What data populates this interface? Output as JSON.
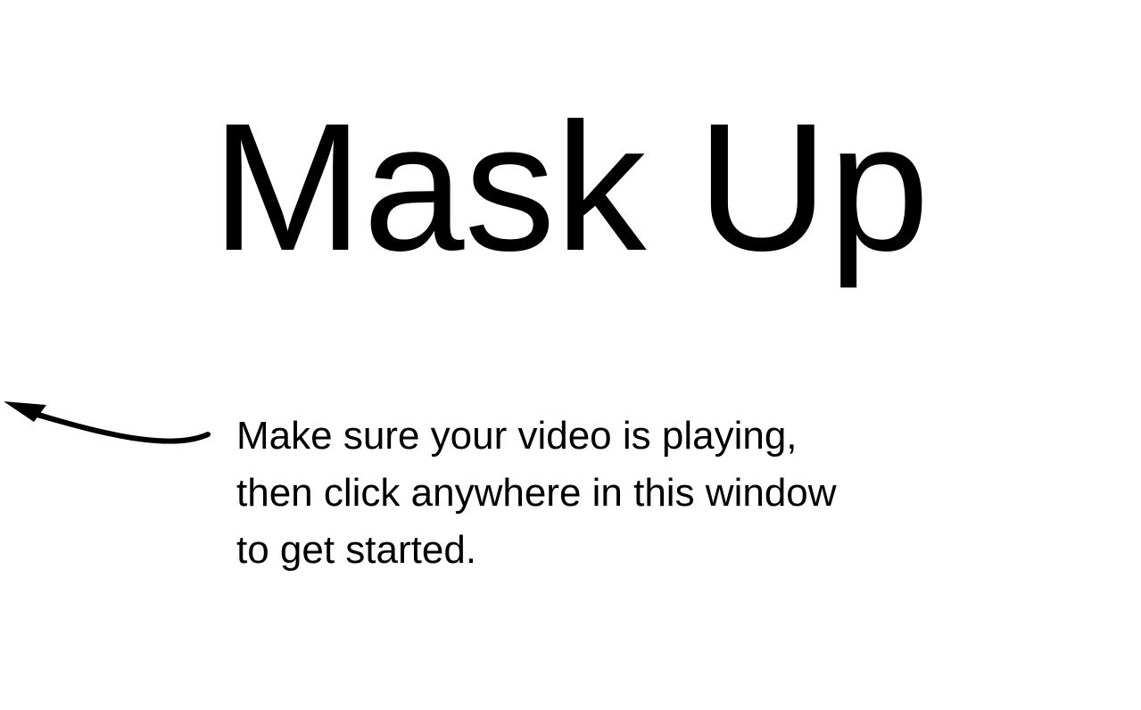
{
  "title": "Mask Up",
  "instructions": {
    "lines": [
      "Make sure your video is playing,",
      "then click anywhere in this window",
      "to get started."
    ]
  },
  "arrow": {
    "icon": "curved-arrow-left-icon",
    "color": "#000000"
  },
  "colors": {
    "background": "#ffffff",
    "text": "#000000"
  }
}
